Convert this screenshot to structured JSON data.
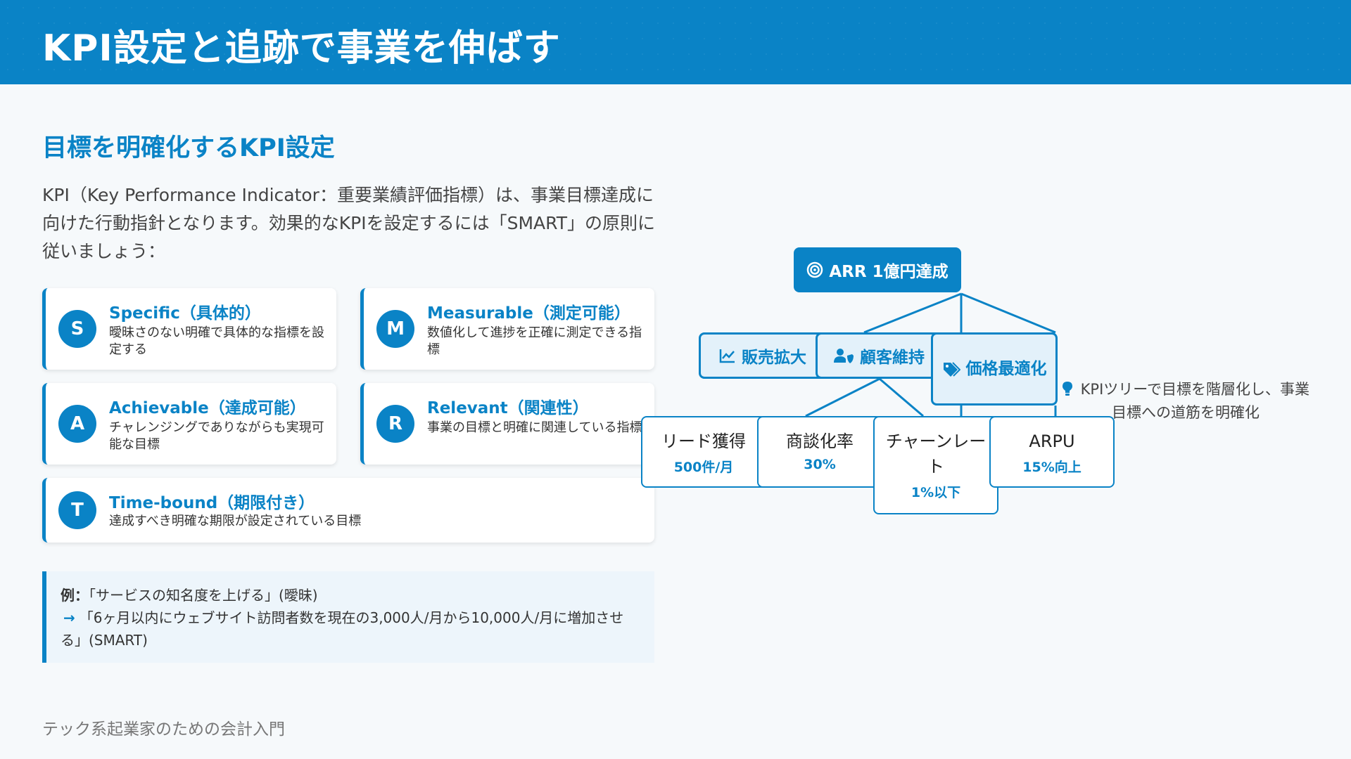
{
  "header": {
    "title": "KPI設定と追跡で事業を伸ばす"
  },
  "section": {
    "title": "目標を明確化するKPI設定",
    "intro": "KPI（Key Performance Indicator：重要業績評価指標）は、事業目標達成に向けた行動指針となります。効果的なKPIを設定するには「SMART」の原則に従いましょう："
  },
  "smart": [
    {
      "letter": "S",
      "title": "Specific（具体的）",
      "desc": "曖昧さのない明確で具体的な指標を設定する"
    },
    {
      "letter": "M",
      "title": "Measurable（測定可能）",
      "desc": "数値化して進捗を正確に測定できる指標"
    },
    {
      "letter": "A",
      "title": "Achievable（達成可能）",
      "desc": "チャレンジングでありながらも実現可能な目標"
    },
    {
      "letter": "R",
      "title": "Relevant（関連性）",
      "desc": "事業の目標と明確に関連している指標"
    },
    {
      "letter": "T",
      "title": "Time-bound（期限付き）",
      "desc": "達成すべき明確な期限が設定されている目標"
    }
  ],
  "example": {
    "label": "例：",
    "bad": "「サービスの知名度を上げる」(曖昧)",
    "arrow": "→",
    "good": "「6ヶ月以内にウェブサイト訪問者数を現在の3,000人/月から10,000人/月に増加させる」(SMART)"
  },
  "tree": {
    "root": "ARR 1億円達成",
    "mid": [
      {
        "label": "販売拡大",
        "icon": "chart-line-icon"
      },
      {
        "label": "顧客維持",
        "icon": "user-shield-icon"
      },
      {
        "label": "価格最適化",
        "icon": "tags-icon"
      }
    ],
    "leaves": [
      {
        "label": "リード獲得",
        "value": "500件/月"
      },
      {
        "label": "商談化率",
        "value": "30%"
      },
      {
        "label": "チャーンレート",
        "value": "1%以下"
      },
      {
        "label": "ARPU",
        "value": "15%向上"
      }
    ],
    "note": "KPIツリーで目標を階層化し、事業目標への道筋を明確化",
    "note_icon": "lightbulb-icon"
  },
  "footer": {
    "text": "テック系起業家のための会計入門"
  },
  "colors": {
    "accent": "#0a83c6",
    "light": "#e3f1fa"
  }
}
